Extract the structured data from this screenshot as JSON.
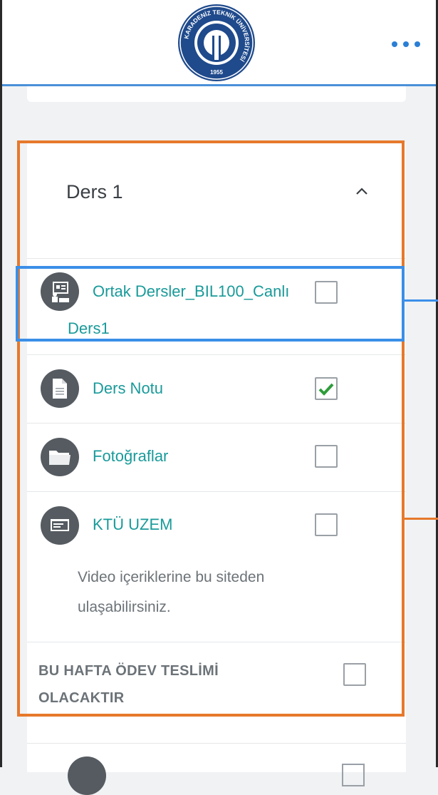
{
  "header": {
    "logo_text": "KARADENİZ TEKNİK ÜNİVERSİTESİ",
    "logo_year": "1955",
    "more_icon": "more-horizontal-icon"
  },
  "section": {
    "title": "Ders 1",
    "collapse_icon": "chevron-up-icon"
  },
  "activities": [
    {
      "icon": "presentation-icon",
      "label_line1": "Ortak Dersler_BIL100_Canlı",
      "label_line2": "Ders1",
      "completed": false
    },
    {
      "icon": "document-icon",
      "label": "Ders Notu",
      "completed": true
    },
    {
      "icon": "folder-icon",
      "label": "Fotoğraflar",
      "completed": false
    },
    {
      "icon": "url-icon",
      "label": "KTÜ UZEM",
      "description_line1": "Video içeriklerine bu siteden",
      "description_line2": "ulaşabilirsiniz.",
      "completed": false
    }
  ],
  "label_item": {
    "line1": "BU HAFTA ÖDEV TESLİMİ",
    "line2": "OLACAKTIR",
    "completed": false
  },
  "colors": {
    "link": "#1a9a9a",
    "highlight_orange": "#e6792b",
    "highlight_blue": "#3b8fe8",
    "check_green": "#2e9c3a",
    "header_accent": "#4a90d9"
  }
}
